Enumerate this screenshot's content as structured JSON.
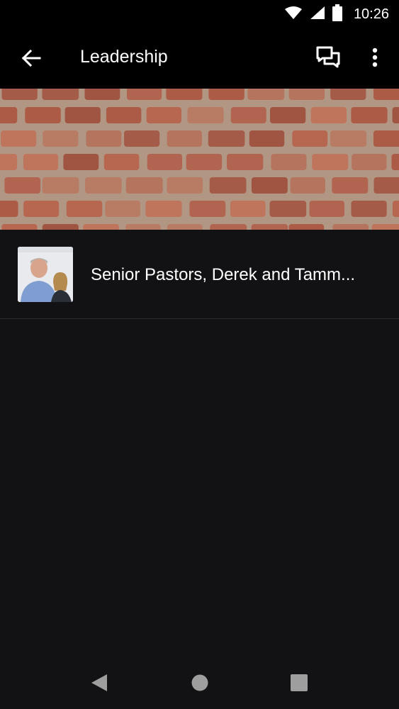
{
  "status_bar": {
    "time": "10:26"
  },
  "app_bar": {
    "title": "Leadership"
  },
  "list": {
    "items": [
      {
        "title": "Senior Pastors, Derek and Tamm..."
      }
    ]
  }
}
